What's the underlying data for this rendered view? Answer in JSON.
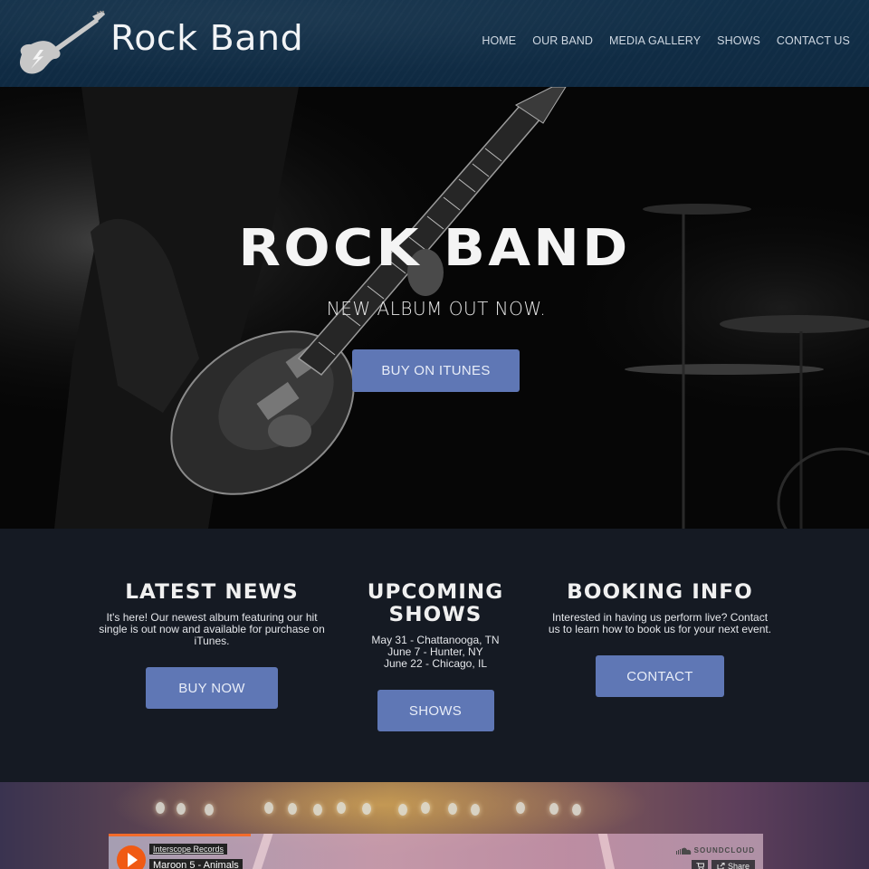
{
  "header": {
    "logo_icon": "electric-guitar-icon",
    "brand": "Rock Band",
    "nav": [
      {
        "label": "HOME"
      },
      {
        "label": "OUR BAND"
      },
      {
        "label": "MEDIA GALLERY"
      },
      {
        "label": "SHOWS"
      },
      {
        "label": "CONTACT US"
      }
    ]
  },
  "hero": {
    "title": "ROCK BAND",
    "subtitle": "NEW ALBUM OUT NOW.",
    "button": "BUY ON ITUNES"
  },
  "info": {
    "news": {
      "title": "LATEST NEWS",
      "text": "It's here! Our newest album featuring our hit single is out now and available for purchase on iTunes.",
      "button": "BUY NOW"
    },
    "shows": {
      "title_line1": "UPCOMING",
      "title_line2": "SHOWS",
      "dates": [
        "May 31 - Chattanooga, TN",
        "June 7 - Hunter, NY",
        "June 22 - Chicago, IL"
      ],
      "button": "SHOWS"
    },
    "booking": {
      "title": "BOOKING INFO",
      "text": "Interested in having us perform live? Contact us to learn how to book us for your next event.",
      "button": "CONTACT"
    }
  },
  "soundcloud": {
    "label": "Interscope Records",
    "track": "Maroon 5 - Animals",
    "brand": "SOUNDCLOUD",
    "share": "Share",
    "icons": {
      "play": "play-icon",
      "cart": "cart-icon",
      "share": "share-icon",
      "brand": "soundcloud-cloud-icon"
    }
  },
  "colors": {
    "header_bg": "#0f2a42",
    "accent_button": "#5f77b5",
    "info_bg": "#151a23",
    "soundcloud_orange": "#f05a14"
  }
}
